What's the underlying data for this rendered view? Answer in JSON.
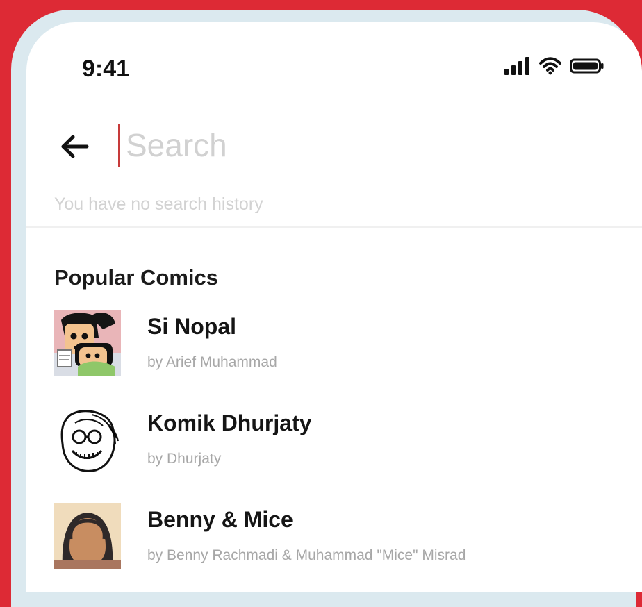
{
  "status_bar": {
    "time": "9:41"
  },
  "search": {
    "placeholder": "Search",
    "value": "",
    "history_note": "You have no search history"
  },
  "popular": {
    "title": "Popular Comics",
    "items": [
      {
        "title": "Si Nopal",
        "author": "by Arief Muhammad"
      },
      {
        "title": "Komik Dhurjaty",
        "author": "by Dhurjaty"
      },
      {
        "title": "Benny & Mice",
        "author": "by Benny Rachmadi & Muhammad \"Mice\" Misrad"
      }
    ]
  },
  "icons": {
    "back": "back-arrow-icon",
    "signal": "cellular-signal-icon",
    "wifi": "wifi-icon",
    "battery": "battery-icon"
  },
  "colors": {
    "background_red": "#dd2a35",
    "phone_bezel": "#dbe9ef",
    "screen": "#ffffff",
    "cursor": "#c73a3a",
    "muted_text": "#d2d2d2"
  }
}
